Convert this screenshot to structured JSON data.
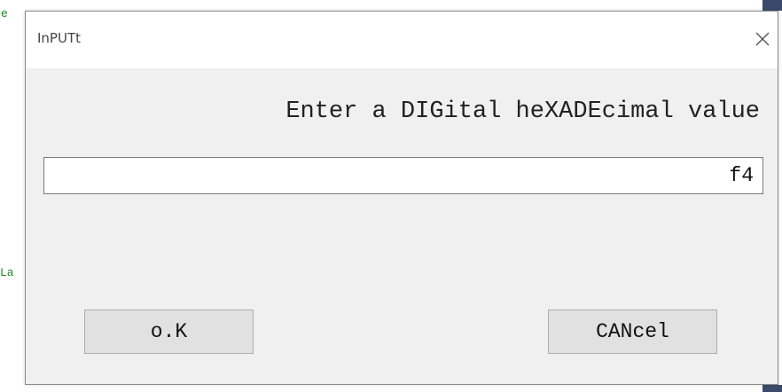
{
  "background": {
    "fragment_top": "e",
    "fragment_mid": "La"
  },
  "dialog": {
    "title": "InPUTt",
    "close_icon": "close-icon",
    "prompt": "Enter a DIGital heXADEcimal value",
    "input_value": "f4",
    "ok_label": "o.K",
    "cancel_label": "CANcel"
  },
  "colors": {
    "dialog_bg": "#f0f0f0",
    "titlebar_bg": "#ffffff",
    "button_bg": "#e1e1e1",
    "background_text": "#1a8a1a"
  }
}
